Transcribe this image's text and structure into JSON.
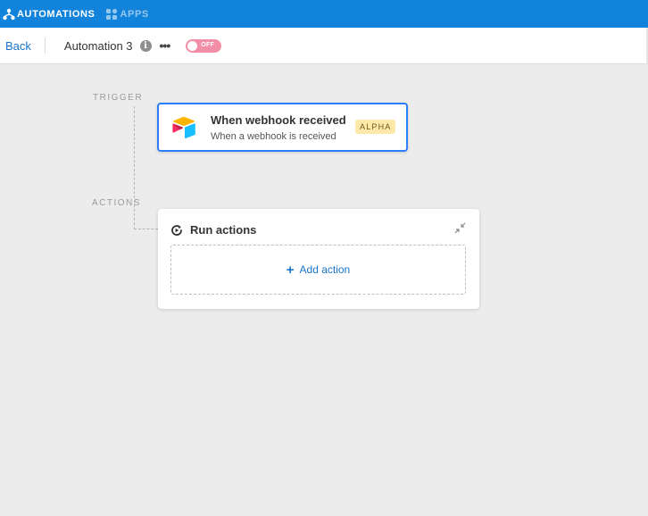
{
  "topnav": {
    "automations_label": "AUTOMATIONS",
    "apps_label": "APPS",
    "bg_color": "#1283da"
  },
  "subbar": {
    "back_label": "Back",
    "automation_name": "Automation 3",
    "info_icon": "info-icon",
    "more_icon": "ellipsis-icon",
    "toggle_label": "OFF",
    "toggle_color": "#f38ea7"
  },
  "flow": {
    "trigger_section_label": "TRIGGER",
    "actions_section_label": "ACTIONS"
  },
  "trigger": {
    "title": "When webhook received",
    "subtitle": "When a webhook is received",
    "badge": "ALPHA",
    "icon": "airtable-logo-icon",
    "selected_border_color": "#2d7ff9"
  },
  "actions": {
    "title": "Run actions",
    "add_label": "Add action",
    "add_icon": "plus-icon",
    "header_icon": "run-actions-icon",
    "collapse_icon": "collapse-icon"
  }
}
